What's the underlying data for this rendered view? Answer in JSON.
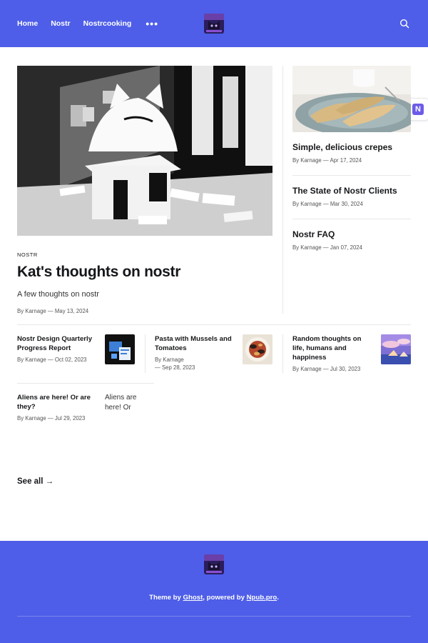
{
  "nav": {
    "items": [
      "Home",
      "Nostr",
      "Nostrcooking"
    ],
    "more_icon": "ellipsis-icon",
    "search_icon": "search-icon"
  },
  "colors": {
    "brand": "#4e5ee8",
    "nostr_badge": "#6d5ce8"
  },
  "floating": {
    "badge": "N"
  },
  "hero": {
    "tag": "NOSTR",
    "title": "Kat's thoughts on nostr",
    "excerpt": "A few thoughts on nostr",
    "meta": "By Karnage — May 13, 2024"
  },
  "sidebar": [
    {
      "title": "Simple, delicious crepes",
      "meta": "By Karnage — Apr 17, 2024"
    },
    {
      "title": "The State of Nostr Clients",
      "meta": "By Karnage — Mar 30, 2024"
    },
    {
      "title": "Nostr FAQ",
      "meta": "By Karnage — Jan 07, 2024"
    }
  ],
  "grid": [
    {
      "title": "Nostr Design Quarterly Progress Report",
      "meta": "By Karnage — Oct 02, 2023"
    },
    {
      "title": "Pasta with Mussels and Tomatoes",
      "meta": "By Karnage\n— Sep 28, 2023"
    },
    {
      "title": "Random thoughts on life, humans and happiness",
      "meta": "By Karnage — Jul 30, 2023"
    },
    {
      "title": "Aliens are here! Or are they?",
      "meta": "By Karnage — Jul 29, 2023",
      "alt": "Aliens are here! Or"
    }
  ],
  "see_all": "See all →",
  "footer": {
    "prefix": "Theme by ",
    "ghost": "Ghost",
    "middle": ", powered by ",
    "npub": "Npub.pro",
    "suffix": "."
  }
}
